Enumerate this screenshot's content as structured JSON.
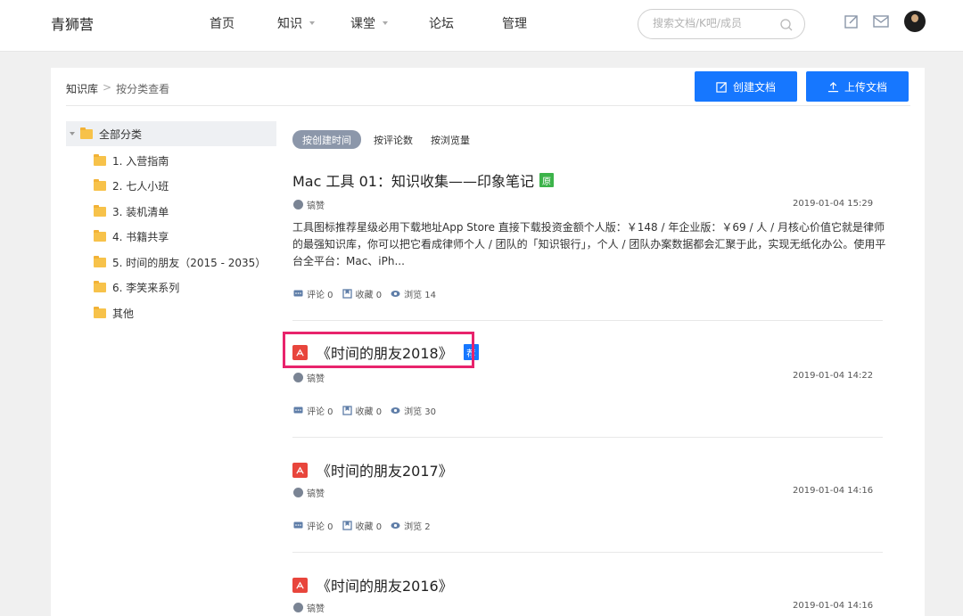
{
  "header": {
    "brand": "青狮营",
    "nav": [
      {
        "label": "首页"
      },
      {
        "label": "知识"
      },
      {
        "label": "课堂"
      },
      {
        "label": "论坛"
      },
      {
        "label": "管理"
      }
    ],
    "search_placeholder": "搜索文档/K吧/成员"
  },
  "breadcrumb": {
    "root": "知识库",
    "separator": ">",
    "current": "按分类查看"
  },
  "actions": {
    "create_label": "创建文档",
    "upload_label": "上传文档",
    "button_color": "#1677ff"
  },
  "tree": {
    "root": "全部分类",
    "items": [
      "1. 入营指南",
      "2. 七人小班",
      "3. 装机清单",
      "4. 书籍共享",
      "5. 时间的朋友（2015 - 2035）",
      "6. 李笑来系列",
      "其他"
    ]
  },
  "sort": {
    "tabs": [
      "按创建时间",
      "按评论数",
      "按浏览量"
    ],
    "active": "按创建时间"
  },
  "articles": [
    {
      "title": "Mac 工具 01：知识收集——印象笔记",
      "badge": "原",
      "author": "镐赞",
      "date": "2019-01-04 15:29",
      "summary": "工具图标推荐星级必用下载地址App Store 直接下载投资金额个人版：￥148 / 年企业版：￥69 / 人 / 月核心价值它就是律师的最强知识库，你可以把它看成律师个人 / 团队的「知识银行」，个人 / 团队办案数据都会汇聚于此，实现无纸化办公。使用平台全平台：Mac、iPh...",
      "comments": "评论 0",
      "favorites": "收藏 0",
      "views": "浏览 14"
    },
    {
      "title": "《时间的朋友2018》",
      "badge": "荐",
      "author": "镐赞",
      "date": "2019-01-04 14:22",
      "comments": "评论 0",
      "favorites": "收藏 0",
      "views": "浏览 30"
    },
    {
      "title": "《时间的朋友2017》",
      "author": "镐赞",
      "date": "2019-01-04 14:16",
      "comments": "评论 0",
      "favorites": "收藏 0",
      "views": "浏览 2"
    },
    {
      "title": "《时间的朋友2016》",
      "author": "镐赞",
      "date": "2019-01-04 14:16"
    }
  ]
}
